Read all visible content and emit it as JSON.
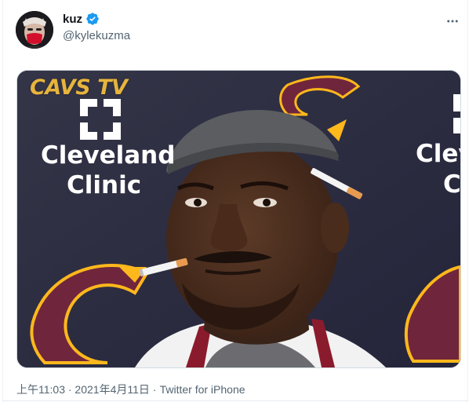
{
  "tweet": {
    "author": {
      "display_name": "kuz",
      "handle": "@kylekuzma",
      "verified": true
    },
    "media": {
      "brand": "CAVS TV",
      "sponsor_line_1": "Cleveland",
      "sponsor_line_2": "Clinic",
      "sponsor_right_1": "Clev",
      "sponsor_right_2": "C"
    },
    "timestamp": "上午11:03 · 2021年4月11日",
    "separator": "·",
    "source": "Twitter for iPhone"
  },
  "colors": {
    "accent": "#1d9bf0",
    "text": "#0f1419",
    "muted": "#536471",
    "cavs_wine": "#6f263d",
    "cavs_gold": "#ffb81c",
    "backdrop_navy": "#2b2b3d"
  },
  "icons": {
    "verified": "verified-badge-icon",
    "more": "more-options-icon",
    "avatar": "avatar-red-mask"
  }
}
